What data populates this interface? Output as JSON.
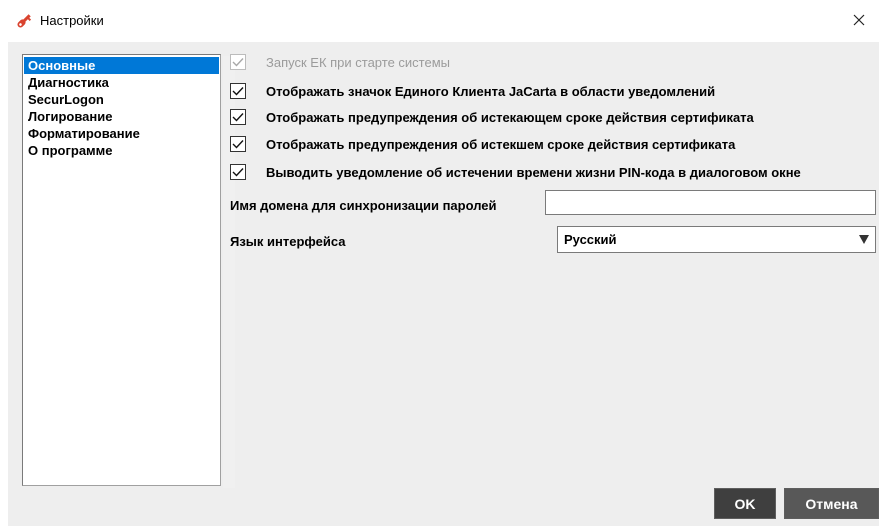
{
  "window": {
    "title": "Настройки",
    "close_symbol": "✕",
    "app_icon": "key-icon"
  },
  "sidebar": {
    "items": [
      {
        "label": "Основные",
        "selected": true
      },
      {
        "label": "Диагностика",
        "selected": false
      },
      {
        "label": "SecurLogon",
        "selected": false
      },
      {
        "label": "Логирование",
        "selected": false
      },
      {
        "label": "Форматирование",
        "selected": false
      },
      {
        "label": "О программе",
        "selected": false
      }
    ]
  },
  "options": [
    {
      "label": "Запуск ЕК при старте системы",
      "checked": true,
      "disabled": true
    },
    {
      "label": "Отображать значок Единого Клиента JaCarta в области уведомлений",
      "checked": true,
      "disabled": false
    },
    {
      "label": "Отображать предупреждения об истекающем сроке действия сертификата",
      "checked": true,
      "disabled": false
    },
    {
      "label": "Отображать предупреждения об истекшем сроке действия сертификата",
      "checked": true,
      "disabled": false
    },
    {
      "label": "Выводить уведомление об истечении времени жизни PIN-кода в диалоговом окне",
      "checked": true,
      "disabled": false
    }
  ],
  "domain_field": {
    "label": "Имя домена для синхронизации паролей",
    "value": ""
  },
  "language": {
    "label": "Язык интерфейса",
    "selected": "Русский"
  },
  "buttons": {
    "ok": "OK",
    "cancel": "Отмена"
  },
  "colors": {
    "selection": "#0078d7",
    "icon_red": "#d9432f",
    "button_dark": "#3f3f3f"
  }
}
